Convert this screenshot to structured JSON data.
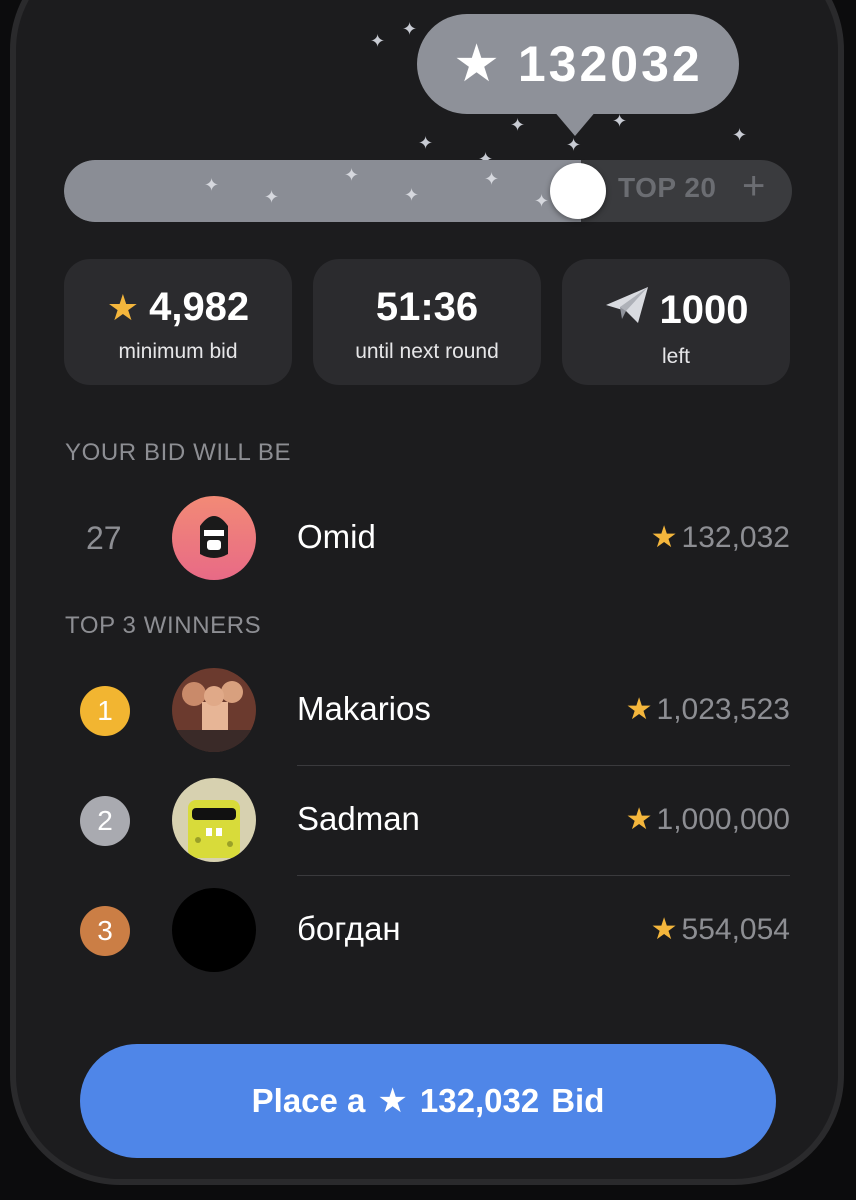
{
  "bid_bubble": {
    "star_icon": "star-icon",
    "value": "132032"
  },
  "slider": {
    "label": "TOP 20",
    "plus": "+",
    "fill_fraction": 0.71
  },
  "stats": [
    {
      "value": "4,982",
      "label": "minimum bid",
      "icon": "gold-star-icon"
    },
    {
      "value": "51:36",
      "label": "until next round",
      "icon": ""
    },
    {
      "value": "1000",
      "label": "left",
      "icon": "paper-plane-icon"
    }
  ],
  "your_bid": {
    "section_label": "YOUR BID WILL BE",
    "rank": "27",
    "name": "Omid",
    "amount": "132,032"
  },
  "winners": {
    "section_label": "TOP 3 WINNERS",
    "items": [
      {
        "rank": "1",
        "name": "Makarios",
        "amount": "1,023,523",
        "medal_color": "#f2b531"
      },
      {
        "rank": "2",
        "name": "Sadman",
        "amount": "1,000,000",
        "medal_color": "#a9aab0"
      },
      {
        "rank": "3",
        "name": "богдан",
        "amount": "554,054",
        "medal_color": "#cb7e45"
      }
    ]
  },
  "cta": {
    "prefix": "Place a",
    "amount": "132,032",
    "suffix": "Bid"
  },
  "colors": {
    "accent": "#4f86e8",
    "star": "#f4b63c",
    "background": "#1c1c1e"
  }
}
